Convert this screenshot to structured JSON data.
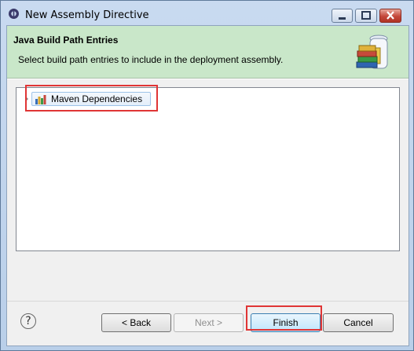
{
  "window": {
    "title": "New Assembly Directive"
  },
  "header": {
    "title": "Java Build Path Entries",
    "description": "Select build path entries to include in the deployment assembly.",
    "graphic_icon": "jar-books-icon"
  },
  "entries": [
    {
      "label": "Maven Dependencies",
      "icon": "library-icon"
    }
  ],
  "buttons": {
    "help": "?",
    "back": "< Back",
    "next": "Next >",
    "finish": "Finish",
    "cancel": "Cancel"
  },
  "colors": {
    "header_bg": "#c9e7c9",
    "highlight_red": "#e03535"
  }
}
